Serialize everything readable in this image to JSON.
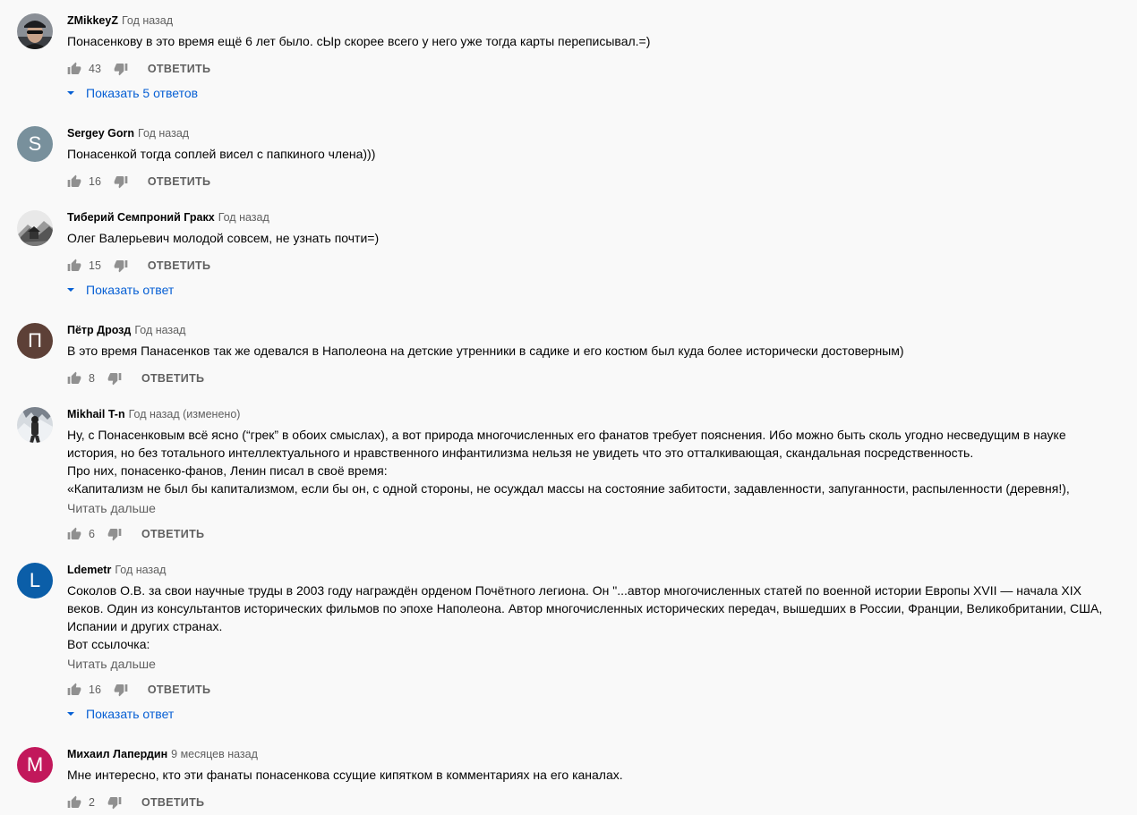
{
  "colors": {
    "text": "#030303",
    "secondary": "#606060",
    "link": "#065fd4",
    "background": "#f9f9f9"
  },
  "ui": {
    "reply_label": "ОТВЕТИТЬ",
    "read_more_label": "Читать дальше"
  },
  "comments": [
    {
      "author": "ZMikkeyZ",
      "time": "Год назад",
      "avatar_icon": "photo-avatar-man-in-cap",
      "lines": [
        "Понасенкову в это время ещё 6 лет было. сЫр скорее всего у него уже тогда карты переписывал.=)"
      ],
      "likes": "43",
      "show_replies": "Показать 5 ответов"
    },
    {
      "author": "Sergey Gorn",
      "time": "Год назад",
      "avatar_letter": "S",
      "avatar_color": "#78909c",
      "lines": [
        "Понасенкой тогда соплей висел с папкиного члена)))"
      ],
      "likes": "16"
    },
    {
      "author": "Тиберий Семпроний Гракх",
      "time": "Год назад",
      "avatar_icon": "photo-avatar-sketch",
      "lines": [
        "Олег Валерьевич молодой совсем, не узнать почти=)"
      ],
      "likes": "15",
      "show_replies": "Показать ответ"
    },
    {
      "author": "Пётр Дрозд",
      "time": "Год назад",
      "avatar_letter": "П",
      "avatar_color": "#5d4037",
      "lines": [
        "В это время Панасенков так же одевался в Наполеона на детские утренники в садике и его костюм был куда более исторически достоверным)"
      ],
      "likes": "8"
    },
    {
      "author": "Mikhail T-n",
      "time": "Год назад (изменено)",
      "avatar_icon": "photo-avatar-winter",
      "lines": [
        "Ну, с Понасенковым всё ясно (“грек” в обоих смыслах), а вот природа многочисленных его фанатов требует пояснения. Ибо можно быть сколь угодно несведущим в науке",
        "история, но без тотального интеллектуального  и нравственного инфантилизма нельзя не увидеть что это отталкивающая, скандальная посредственность.",
        "Про них, понасенко-фанов, Ленин писал в своё время:",
        "«Капитализм не был бы капитализмом, если бы он, с одной стороны, не осуждал массы на состояние забитости, задавленности, запуганности, распыленности (деревня!),"
      ],
      "read_more": true,
      "likes": "6"
    },
    {
      "author": "Ldemetr",
      "time": "Год назад",
      "avatar_letter": "L",
      "avatar_color": "#0b5ea8",
      "lines": [
        "Соколов О.В. за свои научные труды в 2003 году награждён орденом Почётного легиона. Он \"...автор многочисленных статей по военной истории Европы XVII — начала XIX",
        "веков. Один из консультантов исторических фильмов по эпохе Наполеона. Автор многочисленных исторических передач, вышедших в России, Франции, Великобритании, США,",
        "Испании и других странах.",
        "Вот ссылочка:"
      ],
      "read_more": true,
      "likes": "16",
      "show_replies": "Показать ответ"
    },
    {
      "author": "Михаил Лапердин",
      "time": "9 месяцев назад",
      "avatar_letter": "M",
      "avatar_color": "#c2185b",
      "lines": [
        "Мне интересно, кто эти фанаты понасенкова ссущие кипятком в комментариях на его каналах."
      ],
      "likes": "2"
    }
  ]
}
